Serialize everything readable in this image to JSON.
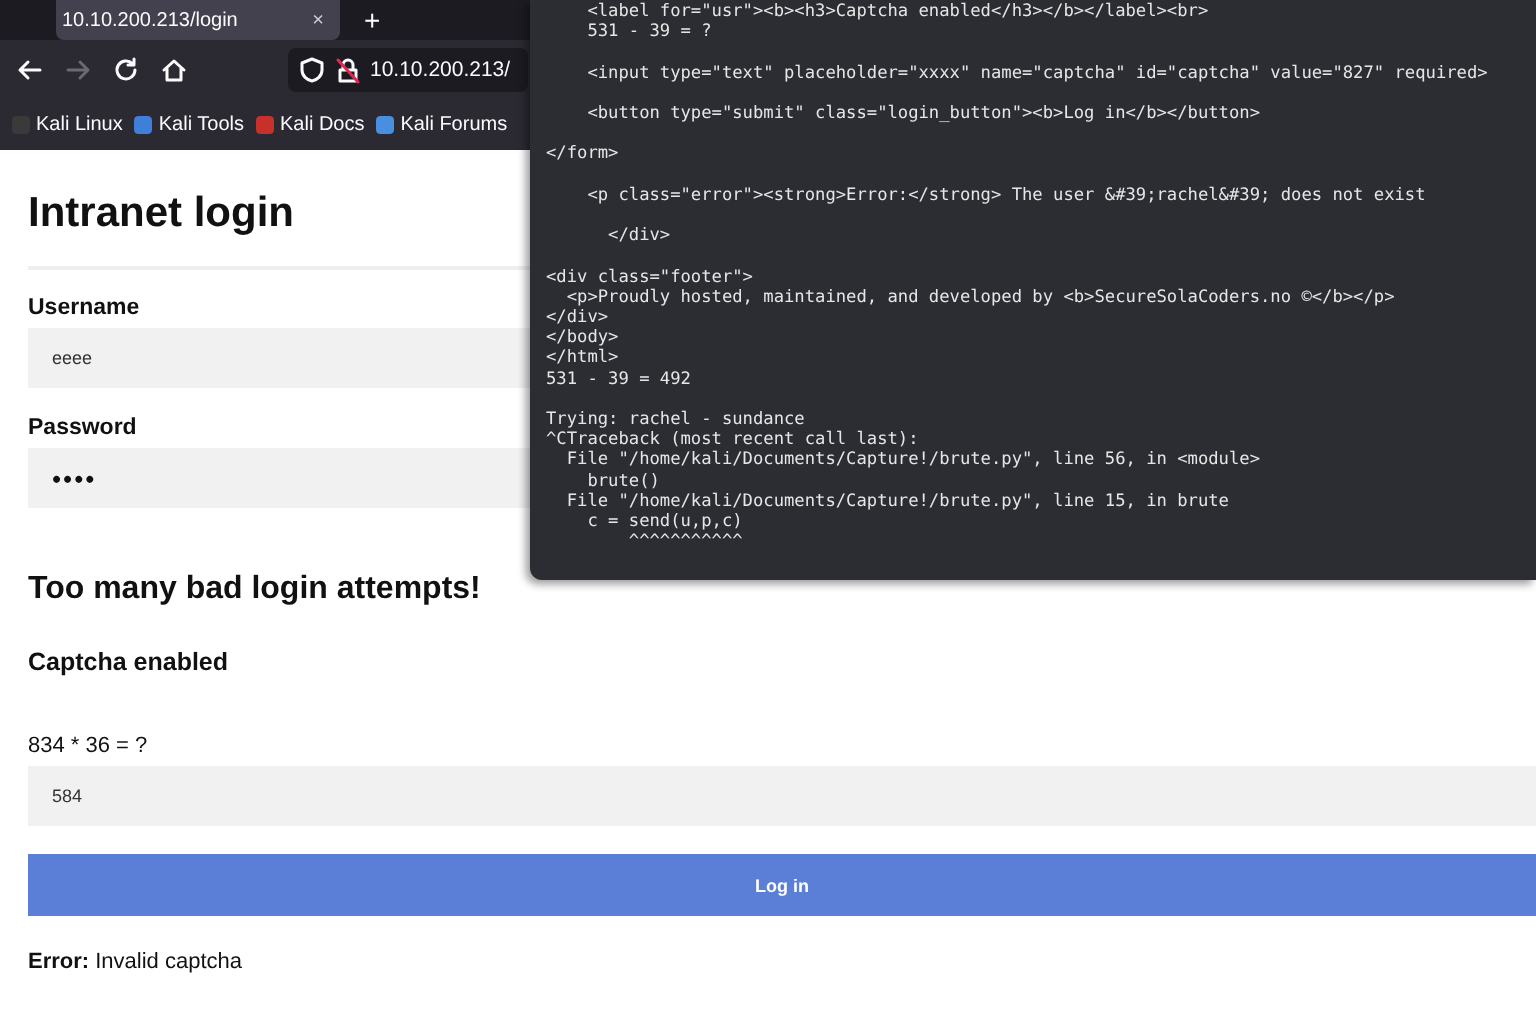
{
  "browser": {
    "tab": {
      "title": "10.10.200.213/login",
      "close": "×"
    },
    "new_tab": "+",
    "nav": {
      "forward_disabled": true
    },
    "url": "10.10.200.213/",
    "bookmarks": [
      {
        "label": "Kali Linux",
        "color": "#3a3a3a"
      },
      {
        "label": "Kali Tools",
        "color": "#3f7fd9"
      },
      {
        "label": "Kali Docs",
        "color": "#c8302c"
      },
      {
        "label": "Kali Forums",
        "color": "#4a8ee0"
      }
    ]
  },
  "page": {
    "title": "Intranet login",
    "fields": [
      {
        "label": "Username",
        "value": "eeee",
        "kind": "text"
      },
      {
        "label": "Password",
        "value": "••••",
        "kind": "password"
      }
    ],
    "warning": "Too many bad login attempts!",
    "captcha_heading": "Captcha enabled",
    "captcha_question": "834 * 36 = ?",
    "captcha_value": "584",
    "login_button": "Log in",
    "error": "**Error:** Invalid captcha"
  },
  "terminal": {
    "blocks": [
      [
        "    <label for=\"usr\"><b><h3>Captcha enabled</h3></b></label><br>",
        "    531 - 39 = ?"
      ],
      [
        "    <input type=\"text\" placeholder=\"xxxx\" name=\"captcha\" id=\"captcha\" value=\"827\" required>"
      ],
      [
        "    <button type=\"submit\" class=\"login_button\"><b>Log in</b></button>"
      ],
      [
        "</form>"
      ],
      [
        "    <p class=\"error\"><strong>Error:</strong> The user &#39;rachel&#39; does not exist"
      ],
      [
        "      </div>"
      ],
      [
        "<div class=\"footer\">",
        "  <p>Proudly hosted, maintained, and developed by <b>SecureSolaCoders.no ©</b></p>",
        "</div>",
        "</body>",
        "</html>",
        "531 - 39 = 492"
      ],
      [
        "Trying: rachel - sundance",
        "^CTraceback (most recent call last):",
        "  File \"/home/kali/Documents/Capture!/brute.py\", line 56, in <module>",
        "    brute()",
        "  File \"/home/kali/Documents/Capture!/brute.py\", line 15, in brute",
        "    c = send(u,p,c)",
        "        ^^^^^^^^^^^"
      ]
    ]
  }
}
